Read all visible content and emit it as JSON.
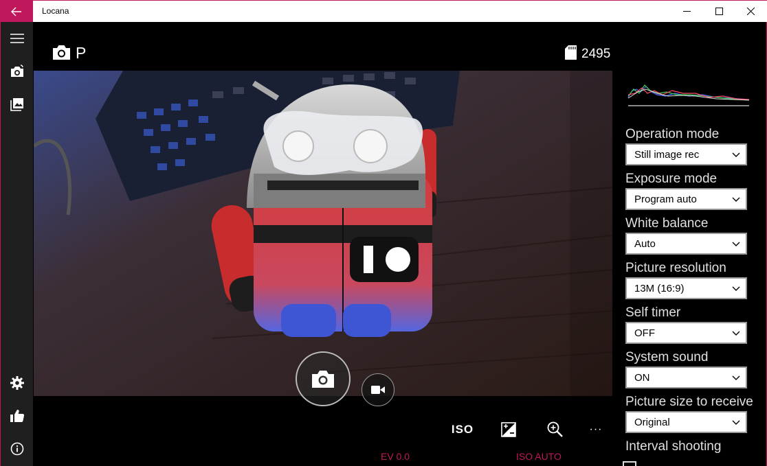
{
  "window": {
    "title": "Locana",
    "back_icon": "arrow-left-icon",
    "controls": [
      "minimize-icon",
      "maximize-icon",
      "close-icon"
    ],
    "accent_color": "#c0185a"
  },
  "nav": {
    "items": [
      "hamburger-menu-icon",
      "switch-camera-icon",
      "gallery-icon"
    ],
    "bottom_items": [
      "settings-gear-icon",
      "thumbs-up-icon",
      "info-icon"
    ]
  },
  "header": {
    "shooting_mode_icon": "camera-icon",
    "shooting_mode": "P",
    "storage_icon": "sd-card-icon",
    "remaining_shots": "2495"
  },
  "viewfinder": {
    "description_icon": "live-view"
  },
  "controls": {
    "shutter_icon": "camera-icon",
    "video_icon": "video-camera-icon"
  },
  "toolbar": {
    "iso_label": "ISO",
    "ev_icon": "exposure-icon",
    "zoom_icon": "zoom-in-icon",
    "more_label": "···"
  },
  "status": {
    "ev": "EV 0.0",
    "iso": "ISO AUTO"
  },
  "settings": [
    {
      "label": "Operation mode",
      "value": "Still image rec"
    },
    {
      "label": "Exposure mode",
      "value": "Program auto"
    },
    {
      "label": "White balance",
      "value": "Auto"
    },
    {
      "label": "Picture resolution",
      "value": "13M (16:9)"
    },
    {
      "label": "Self timer",
      "value": "OFF"
    },
    {
      "label": "System sound",
      "value": "ON"
    },
    {
      "label": "Picture size to receive",
      "value": "Original"
    }
  ],
  "interval": {
    "label": "Interval shooting"
  }
}
